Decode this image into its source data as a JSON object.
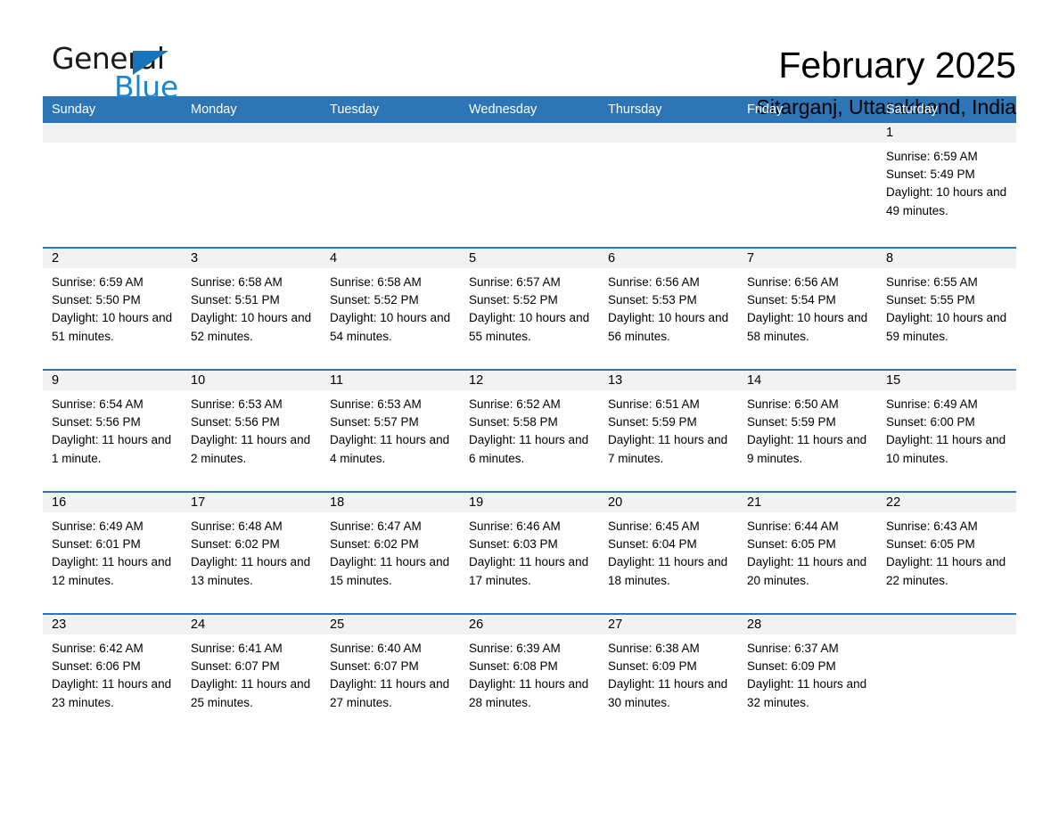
{
  "logo": {
    "text_primary": "General",
    "text_secondary": "Blue",
    "triangle_color": "#1a73b8",
    "secondary_color": "#1a86d0"
  },
  "header": {
    "title": "February 2025",
    "subtitle": "Sitarganj, Uttarakhand, India"
  },
  "theme": {
    "header_blue": "#2e75b6",
    "daynum_band": "#f2f2f2",
    "text": "#000000"
  },
  "calendar": {
    "weekdays": [
      "Sunday",
      "Monday",
      "Tuesday",
      "Wednesday",
      "Thursday",
      "Friday",
      "Saturday"
    ],
    "weeks": [
      [
        {
          "empty": true
        },
        {
          "empty": true
        },
        {
          "empty": true
        },
        {
          "empty": true
        },
        {
          "empty": true
        },
        {
          "empty": true
        },
        {
          "day": "1",
          "sunrise": "Sunrise: 6:59 AM",
          "sunset": "Sunset: 5:49 PM",
          "daylight": "Daylight: 10 hours and 49 minutes."
        }
      ],
      [
        {
          "day": "2",
          "sunrise": "Sunrise: 6:59 AM",
          "sunset": "Sunset: 5:50 PM",
          "daylight": "Daylight: 10 hours and 51 minutes."
        },
        {
          "day": "3",
          "sunrise": "Sunrise: 6:58 AM",
          "sunset": "Sunset: 5:51 PM",
          "daylight": "Daylight: 10 hours and 52 minutes."
        },
        {
          "day": "4",
          "sunrise": "Sunrise: 6:58 AM",
          "sunset": "Sunset: 5:52 PM",
          "daylight": "Daylight: 10 hours and 54 minutes."
        },
        {
          "day": "5",
          "sunrise": "Sunrise: 6:57 AM",
          "sunset": "Sunset: 5:52 PM",
          "daylight": "Daylight: 10 hours and 55 minutes."
        },
        {
          "day": "6",
          "sunrise": "Sunrise: 6:56 AM",
          "sunset": "Sunset: 5:53 PM",
          "daylight": "Daylight: 10 hours and 56 minutes."
        },
        {
          "day": "7",
          "sunrise": "Sunrise: 6:56 AM",
          "sunset": "Sunset: 5:54 PM",
          "daylight": "Daylight: 10 hours and 58 minutes."
        },
        {
          "day": "8",
          "sunrise": "Sunrise: 6:55 AM",
          "sunset": "Sunset: 5:55 PM",
          "daylight": "Daylight: 10 hours and 59 minutes."
        }
      ],
      [
        {
          "day": "9",
          "sunrise": "Sunrise: 6:54 AM",
          "sunset": "Sunset: 5:56 PM",
          "daylight": "Daylight: 11 hours and 1 minute."
        },
        {
          "day": "10",
          "sunrise": "Sunrise: 6:53 AM",
          "sunset": "Sunset: 5:56 PM",
          "daylight": "Daylight: 11 hours and 2 minutes."
        },
        {
          "day": "11",
          "sunrise": "Sunrise: 6:53 AM",
          "sunset": "Sunset: 5:57 PM",
          "daylight": "Daylight: 11 hours and 4 minutes."
        },
        {
          "day": "12",
          "sunrise": "Sunrise: 6:52 AM",
          "sunset": "Sunset: 5:58 PM",
          "daylight": "Daylight: 11 hours and 6 minutes."
        },
        {
          "day": "13",
          "sunrise": "Sunrise: 6:51 AM",
          "sunset": "Sunset: 5:59 PM",
          "daylight": "Daylight: 11 hours and 7 minutes."
        },
        {
          "day": "14",
          "sunrise": "Sunrise: 6:50 AM",
          "sunset": "Sunset: 5:59 PM",
          "daylight": "Daylight: 11 hours and 9 minutes."
        },
        {
          "day": "15",
          "sunrise": "Sunrise: 6:49 AM",
          "sunset": "Sunset: 6:00 PM",
          "daylight": "Daylight: 11 hours and 10 minutes."
        }
      ],
      [
        {
          "day": "16",
          "sunrise": "Sunrise: 6:49 AM",
          "sunset": "Sunset: 6:01 PM",
          "daylight": "Daylight: 11 hours and 12 minutes."
        },
        {
          "day": "17",
          "sunrise": "Sunrise: 6:48 AM",
          "sunset": "Sunset: 6:02 PM",
          "daylight": "Daylight: 11 hours and 13 minutes."
        },
        {
          "day": "18",
          "sunrise": "Sunrise: 6:47 AM",
          "sunset": "Sunset: 6:02 PM",
          "daylight": "Daylight: 11 hours and 15 minutes."
        },
        {
          "day": "19",
          "sunrise": "Sunrise: 6:46 AM",
          "sunset": "Sunset: 6:03 PM",
          "daylight": "Daylight: 11 hours and 17 minutes."
        },
        {
          "day": "20",
          "sunrise": "Sunrise: 6:45 AM",
          "sunset": "Sunset: 6:04 PM",
          "daylight": "Daylight: 11 hours and 18 minutes."
        },
        {
          "day": "21",
          "sunrise": "Sunrise: 6:44 AM",
          "sunset": "Sunset: 6:05 PM",
          "daylight": "Daylight: 11 hours and 20 minutes."
        },
        {
          "day": "22",
          "sunrise": "Sunrise: 6:43 AM",
          "sunset": "Sunset: 6:05 PM",
          "daylight": "Daylight: 11 hours and 22 minutes."
        }
      ],
      [
        {
          "day": "23",
          "sunrise": "Sunrise: 6:42 AM",
          "sunset": "Sunset: 6:06 PM",
          "daylight": "Daylight: 11 hours and 23 minutes."
        },
        {
          "day": "24",
          "sunrise": "Sunrise: 6:41 AM",
          "sunset": "Sunset: 6:07 PM",
          "daylight": "Daylight: 11 hours and 25 minutes."
        },
        {
          "day": "25",
          "sunrise": "Sunrise: 6:40 AM",
          "sunset": "Sunset: 6:07 PM",
          "daylight": "Daylight: 11 hours and 27 minutes."
        },
        {
          "day": "26",
          "sunrise": "Sunrise: 6:39 AM",
          "sunset": "Sunset: 6:08 PM",
          "daylight": "Daylight: 11 hours and 28 minutes."
        },
        {
          "day": "27",
          "sunrise": "Sunrise: 6:38 AM",
          "sunset": "Sunset: 6:09 PM",
          "daylight": "Daylight: 11 hours and 30 minutes."
        },
        {
          "day": "28",
          "sunrise": "Sunrise: 6:37 AM",
          "sunset": "Sunset: 6:09 PM",
          "daylight": "Daylight: 11 hours and 32 minutes."
        },
        {
          "empty": true
        }
      ]
    ]
  }
}
